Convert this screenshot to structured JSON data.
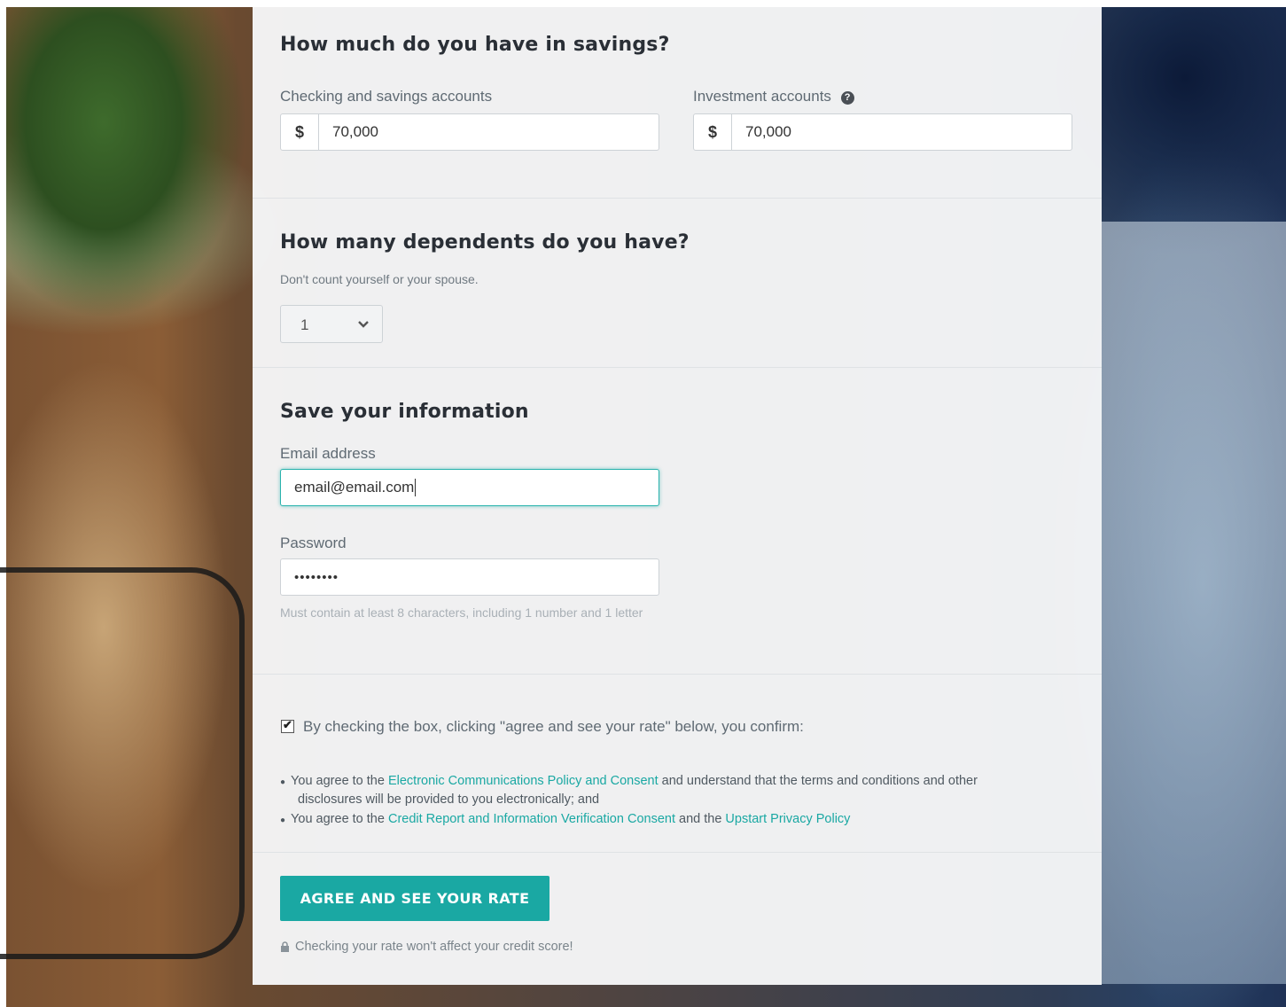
{
  "savings": {
    "heading": "How much do you have in savings?",
    "checking_label": "Checking and savings accounts",
    "checking_prefix": "$",
    "checking_value": "70,000",
    "investment_label": "Investment accounts",
    "investment_prefix": "$",
    "investment_value": "70,000",
    "help_icon_glyph": "?"
  },
  "dependents": {
    "heading": "How many dependents do you have?",
    "hint": "Don't count yourself or your spouse.",
    "selected_value": "1"
  },
  "account": {
    "heading": "Save your information",
    "email_label": "Email address",
    "email_value": "email@email.com",
    "password_label": "Password",
    "password_value": "••••••••",
    "password_hint": "Must contain at least 8 characters, including 1 number and 1 letter"
  },
  "consent": {
    "checkbox_label": "By checking the box, clicking \"agree and see your rate\" below, you confirm:",
    "checkbox_mark": "✔",
    "b1_prefix": "You agree to the ",
    "b1_link": "Electronic Communications Policy and Consent",
    "b1_suffix": " and understand that the terms and conditions and other",
    "b1_line2": "disclosures will be provided to you electronically; and",
    "b2_prefix": "You agree to the ",
    "b2_link1": "Credit Report and Information Verification Consent",
    "b2_middle": " and the ",
    "b2_link2": "Upstart Privacy Policy"
  },
  "submit": {
    "button_label": "AGREE AND SEE YOUR RATE",
    "note": "Checking your rate won't affect your credit score!"
  },
  "colors": {
    "accent": "#1aa8a3",
    "focus_border": "#2ab3ad"
  }
}
